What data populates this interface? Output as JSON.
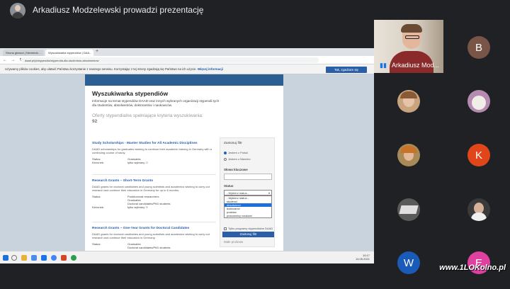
{
  "meet": {
    "presenting_title": "Arkadiusz Modzelewski prowadzi prezentację",
    "main_participant_name": "Arkadiusz Mod...",
    "participants": [
      {
        "initial": "B",
        "color": "#795548"
      },
      {
        "initial": "K",
        "color": "#e0461a"
      },
      {
        "initial": "W",
        "color": "#1a5ab8"
      },
      {
        "initial": "E",
        "color": "#e040a0"
      }
    ],
    "watermark": "www.1LOKolno.pl"
  },
  "browser": {
    "tab1": "Strona główna | Niemiecki ...",
    "tab2": "Wyszukiwarka stypendiów | DAA...",
    "tab_new": "+",
    "nav": "← → ↻",
    "url": "daad.pl/pl/stypendia/stypendia-dla-studentow-absolwentow",
    "cookie_text": "Używamy plików cookies, aby ulatwić Państwu korzystanie z naszego serwisu. Korzystając z tej strony zgadzają się Państwo na ich użycie.",
    "cookie_link": "Więcej informacji",
    "cookie_button": "Tak, zgadzam się"
  },
  "search": {
    "heading": "Wyszukiwarka stypendiów",
    "intro": "Informacje na temat stypendiów DAAD oraz innych wybranych organizacji stypendii tych dla studentów, absolwentów, doktorantów i naukowców.",
    "count_text": "Oferty stypendialne spełniające kryteria wyszukiwania:",
    "count_value": "92",
    "results": [
      {
        "title": "Study Scholarships - Master Studies for All Academic Disciplines",
        "desc": "DAAD scholarships for graduates wishing to continue their academic training in Germany with a continuing course of study.",
        "fields": [
          {
            "k": "Status:",
            "v": "Graduates"
          },
          {
            "k": "Kierunek:",
            "v": "tylko wybrany ☉"
          }
        ]
      },
      {
        "title": "Research Grants – Short-Term Grants",
        "desc": "DAAD grants for doctoral candidates and young scientists and academics wishing to carry out research and continue their education in Germany for up to 6 months.",
        "fields": [
          {
            "k": "Status:",
            "v": "Postdoctoral researchers"
          },
          {
            "k": "",
            "v": "Graduates"
          },
          {
            "k": "",
            "v": "Doctoral candidates/PhD students"
          },
          {
            "k": "Kierunek:",
            "v": "tylko wybrany ☉"
          }
        ]
      },
      {
        "title": "Research Grants – One-Year Grants for Doctoral Candidates",
        "desc": "DAAD grants for doctoral candidates and young scientists and academics wishing to carry out research and continue their education in Germany.",
        "fields": [
          {
            "k": "Status:",
            "v": "Graduates"
          },
          {
            "k": "",
            "v": "Doctoral candidates/PhD students"
          }
        ]
      }
    ]
  },
  "filter": {
    "title": "Zastosuj filtr",
    "radio1": "Jestem z Polski",
    "radio2": "Jestem z Niemiec",
    "keyword_label": "Słowo kluczowe",
    "status_label": "Status",
    "select_value": "- Wybierz status -",
    "options": [
      "- Wybierz status -",
      "studenci",
      "absolwenci",
      "doktoranci",
      "postdoc",
      "pracownicy naukowi"
    ],
    "selected_option": "absolwenci",
    "checkbox": "Tylko programy stypendialne DAAD",
    "button": "Zastosuj filtr",
    "notice_title": "Małe prośewe",
    "notice": "Prosimy o zwrócenie uwagi, iż wszystkie informacje dotyczące stypendiów organizacji innych niż DAAD mają charakter informacyjny."
  },
  "taskbar": {
    "time": "10:17",
    "date": "14.05.2021"
  }
}
